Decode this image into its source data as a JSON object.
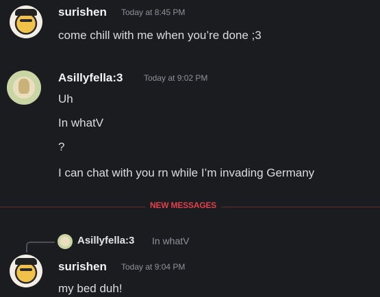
{
  "messages": {
    "m1": {
      "username": "surishen",
      "timestamp": "Today at 8:45 PM",
      "lines": [
        "come chill with me when you’re done ;3"
      ]
    },
    "m2": {
      "username": "Asillyfella:3",
      "timestamp": "Today at 9:02 PM",
      "lines": [
        "Uh",
        "In whatV",
        "?",
        "I can chat with you rn while I’m invading Germany"
      ]
    },
    "divider": {
      "label": "NEW MESSAGES",
      "color": "#e1414c"
    },
    "m3": {
      "reply": {
        "username": "Asillyfella:3",
        "text": "In whatV"
      },
      "username": "surishen",
      "timestamp": "Today at 9:04 PM",
      "lines": [
        "my bed duh!"
      ]
    }
  }
}
